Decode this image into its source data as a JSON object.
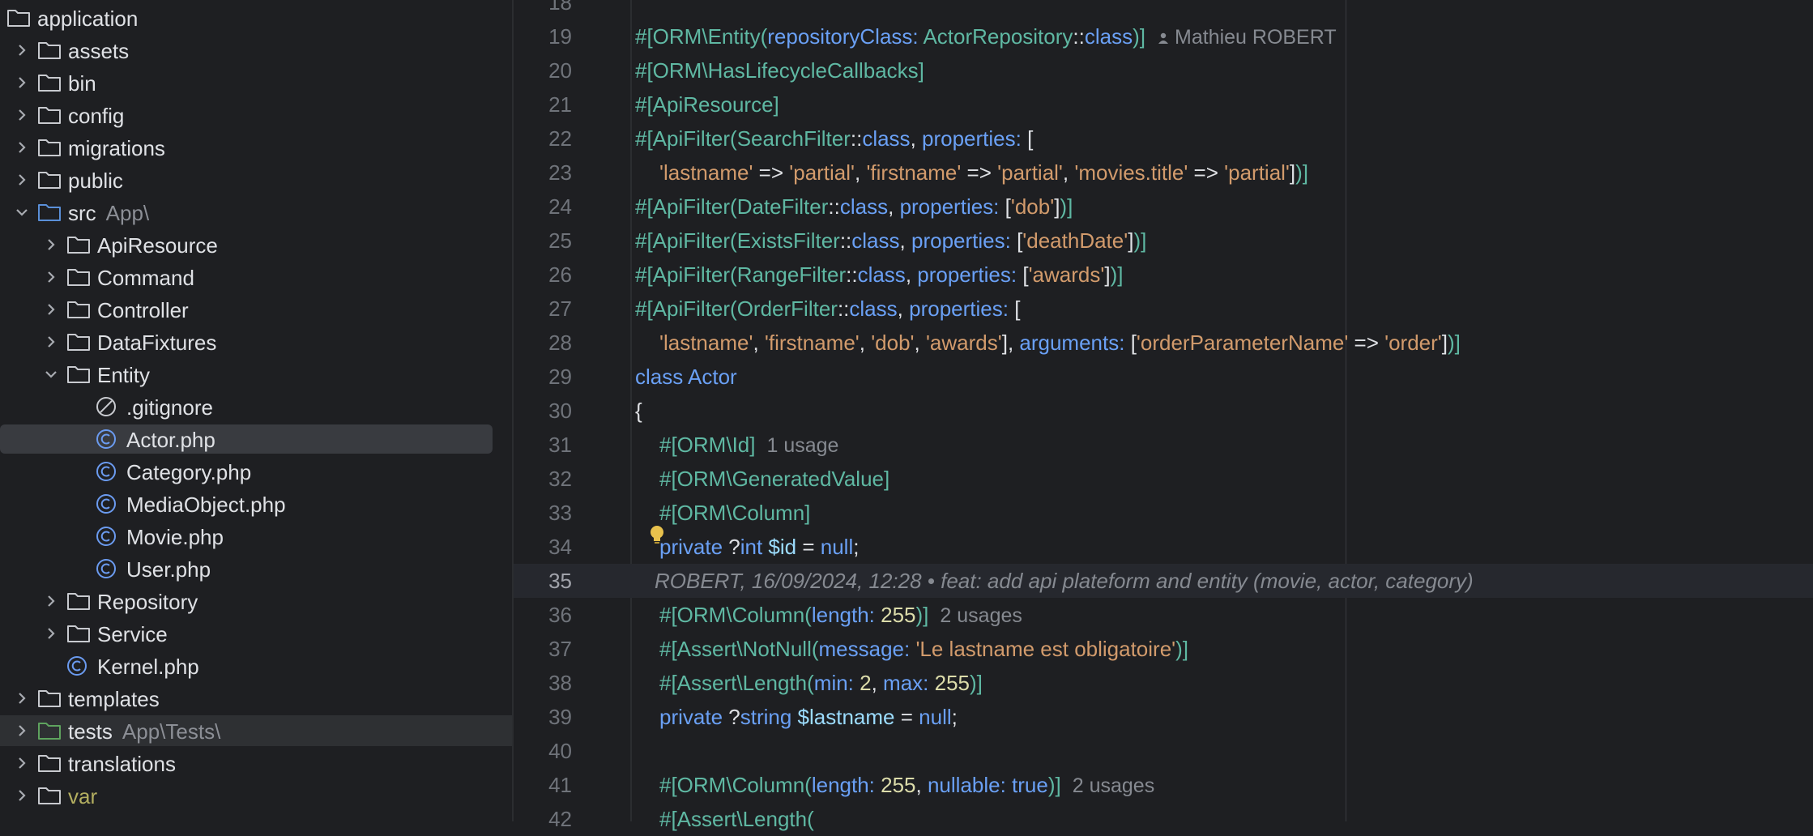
{
  "project_tree": {
    "rows": [
      {
        "label": "application",
        "hint": "",
        "icon": "folder-icon",
        "chevron": "none",
        "indent": 0,
        "color": "default"
      },
      {
        "label": "assets",
        "hint": "",
        "icon": "folder-icon",
        "chevron": "right",
        "indent": 1,
        "color": "default"
      },
      {
        "label": "bin",
        "hint": "",
        "icon": "folder-icon",
        "chevron": "right",
        "indent": 1,
        "color": "default"
      },
      {
        "label": "config",
        "hint": "",
        "icon": "folder-icon",
        "chevron": "right",
        "indent": 1,
        "color": "default"
      },
      {
        "label": "migrations",
        "hint": "",
        "icon": "folder-icon",
        "chevron": "right",
        "indent": 1,
        "color": "default"
      },
      {
        "label": "public",
        "hint": "",
        "icon": "folder-icon",
        "chevron": "right",
        "indent": 1,
        "color": "default"
      },
      {
        "label": "src",
        "hint": "App\\",
        "icon": "source-folder-icon",
        "chevron": "down",
        "indent": 1,
        "color": "default"
      },
      {
        "label": "ApiResource",
        "hint": "",
        "icon": "folder-icon",
        "chevron": "right",
        "indent": 2,
        "color": "default"
      },
      {
        "label": "Command",
        "hint": "",
        "icon": "folder-icon",
        "chevron": "right",
        "indent": 2,
        "color": "default"
      },
      {
        "label": "Controller",
        "hint": "",
        "icon": "folder-icon",
        "chevron": "right",
        "indent": 2,
        "color": "default"
      },
      {
        "label": "DataFixtures",
        "hint": "",
        "icon": "folder-icon",
        "chevron": "right",
        "indent": 2,
        "color": "default"
      },
      {
        "label": "Entity",
        "hint": "",
        "icon": "folder-icon",
        "chevron": "down",
        "indent": 2,
        "color": "default"
      },
      {
        "label": ".gitignore",
        "hint": "",
        "icon": "ignore-file-icon",
        "chevron": "none",
        "indent": 3,
        "color": "default"
      },
      {
        "label": "Actor.php",
        "hint": "",
        "icon": "php-class-icon",
        "chevron": "none",
        "indent": 3,
        "color": "default",
        "selected": true
      },
      {
        "label": "Category.php",
        "hint": "",
        "icon": "php-class-icon",
        "chevron": "none",
        "indent": 3,
        "color": "default"
      },
      {
        "label": "MediaObject.php",
        "hint": "",
        "icon": "php-class-icon",
        "chevron": "none",
        "indent": 3,
        "color": "default"
      },
      {
        "label": "Movie.php",
        "hint": "",
        "icon": "php-class-icon",
        "chevron": "none",
        "indent": 3,
        "color": "default"
      },
      {
        "label": "User.php",
        "hint": "",
        "icon": "php-class-icon",
        "chevron": "none",
        "indent": 3,
        "color": "default"
      },
      {
        "label": "Repository",
        "hint": "",
        "icon": "folder-icon",
        "chevron": "right",
        "indent": 2,
        "color": "default"
      },
      {
        "label": "Service",
        "hint": "",
        "icon": "folder-icon",
        "chevron": "right",
        "indent": 2,
        "color": "default"
      },
      {
        "label": "Kernel.php",
        "hint": "",
        "icon": "php-class-icon",
        "chevron": "none",
        "indent": 2,
        "color": "default"
      },
      {
        "label": "templates",
        "hint": "",
        "icon": "folder-icon",
        "chevron": "right",
        "indent": 1,
        "color": "default"
      },
      {
        "label": "tests",
        "hint": "App\\Tests\\",
        "icon": "test-folder-icon",
        "chevron": "right",
        "indent": 1,
        "color": "default",
        "inactive_selected": true
      },
      {
        "label": "translations",
        "hint": "",
        "icon": "folder-icon",
        "chevron": "right",
        "indent": 1,
        "color": "default"
      },
      {
        "label": "var",
        "hint": "",
        "icon": "folder-icon",
        "chevron": "right",
        "indent": 1,
        "color": "yellow"
      }
    ]
  },
  "editor": {
    "current_line": "35",
    "lines": [
      {
        "n": "18",
        "tokens": []
      },
      {
        "n": "19",
        "indent": 0,
        "tokens": [
          [
            "attr",
            "#[ORM\\Entity("
          ],
          [
            "kw",
            "repositoryClass: "
          ],
          [
            "cls",
            "ActorRepository"
          ],
          [
            "op",
            "::"
          ],
          [
            "kw",
            "class"
          ],
          [
            "attr",
            ")]"
          ]
        ],
        "inlay": "Mathieu ROBERT",
        "inlay_icon": "person-icon"
      },
      {
        "n": "20",
        "indent": 0,
        "tokens": [
          [
            "attr",
            "#[ORM\\HasLifecycleCallbacks]"
          ]
        ]
      },
      {
        "n": "21",
        "indent": 0,
        "tokens": [
          [
            "attr",
            "#[ApiResource]"
          ]
        ]
      },
      {
        "n": "22",
        "indent": 0,
        "tokens": [
          [
            "attr",
            "#[ApiFilter("
          ],
          [
            "cls",
            "SearchFilter"
          ],
          [
            "op",
            "::"
          ],
          [
            "kw",
            "class"
          ],
          [
            "op",
            ", "
          ],
          [
            "kw",
            "properties: "
          ],
          [
            "op",
            "["
          ]
        ]
      },
      {
        "n": "23",
        "indent": 1,
        "tokens": [
          [
            "str",
            "'lastname'"
          ],
          [
            "op",
            " => "
          ],
          [
            "str",
            "'partial'"
          ],
          [
            "op",
            ", "
          ],
          [
            "str",
            "'firstname'"
          ],
          [
            "op",
            " => "
          ],
          [
            "str",
            "'partial'"
          ],
          [
            "op",
            ", "
          ],
          [
            "str",
            "'movies.title'"
          ],
          [
            "op",
            " => "
          ],
          [
            "str",
            "'partial'"
          ],
          [
            "op",
            "]"
          ],
          [
            "attr",
            ")]"
          ]
        ]
      },
      {
        "n": "24",
        "indent": 0,
        "tokens": [
          [
            "attr",
            "#[ApiFilter("
          ],
          [
            "cls",
            "DateFilter"
          ],
          [
            "op",
            "::"
          ],
          [
            "kw",
            "class"
          ],
          [
            "op",
            ", "
          ],
          [
            "kw",
            "properties: "
          ],
          [
            "op",
            "["
          ],
          [
            "str",
            "'dob'"
          ],
          [
            "op",
            "]"
          ],
          [
            "attr",
            ")]"
          ]
        ]
      },
      {
        "n": "25",
        "indent": 0,
        "tokens": [
          [
            "attr",
            "#[ApiFilter("
          ],
          [
            "cls",
            "ExistsFilter"
          ],
          [
            "op",
            "::"
          ],
          [
            "kw",
            "class"
          ],
          [
            "op",
            ", "
          ],
          [
            "kw",
            "properties: "
          ],
          [
            "op",
            "["
          ],
          [
            "str",
            "'deathDate'"
          ],
          [
            "op",
            "]"
          ],
          [
            "attr",
            ")]"
          ]
        ]
      },
      {
        "n": "26",
        "indent": 0,
        "tokens": [
          [
            "attr",
            "#[ApiFilter("
          ],
          [
            "cls",
            "RangeFilter"
          ],
          [
            "op",
            "::"
          ],
          [
            "kw",
            "class"
          ],
          [
            "op",
            ", "
          ],
          [
            "kw",
            "properties: "
          ],
          [
            "op",
            "["
          ],
          [
            "str",
            "'awards'"
          ],
          [
            "op",
            "]"
          ],
          [
            "attr",
            ")]"
          ]
        ]
      },
      {
        "n": "27",
        "indent": 0,
        "tokens": [
          [
            "attr",
            "#[ApiFilter("
          ],
          [
            "cls",
            "OrderFilter"
          ],
          [
            "op",
            "::"
          ],
          [
            "kw",
            "class"
          ],
          [
            "op",
            ", "
          ],
          [
            "kw",
            "properties: "
          ],
          [
            "op",
            "["
          ]
        ]
      },
      {
        "n": "28",
        "indent": 1,
        "tokens": [
          [
            "str",
            "'lastname'"
          ],
          [
            "op",
            ", "
          ],
          [
            "str",
            "'firstname'"
          ],
          [
            "op",
            ", "
          ],
          [
            "str",
            "'dob'"
          ],
          [
            "op",
            ", "
          ],
          [
            "str",
            "'awards'"
          ],
          [
            "op",
            "], "
          ],
          [
            "kw",
            "arguments: "
          ],
          [
            "op",
            "["
          ],
          [
            "str",
            "'orderParameterName'"
          ],
          [
            "op",
            " => "
          ],
          [
            "str",
            "'order'"
          ],
          [
            "op",
            "]"
          ],
          [
            "attr",
            ")]"
          ]
        ]
      },
      {
        "n": "29",
        "indent": 0,
        "tokens": [
          [
            "kw",
            "class "
          ],
          [
            "name",
            "Actor"
          ]
        ]
      },
      {
        "n": "30",
        "indent": 0,
        "tokens": [
          [
            "op",
            "{"
          ]
        ]
      },
      {
        "n": "31",
        "indent": 1,
        "tokens": [
          [
            "attr",
            "#[ORM\\Id]"
          ]
        ],
        "inlay": "1 usage"
      },
      {
        "n": "32",
        "indent": 1,
        "tokens": [
          [
            "attr",
            "#[ORM\\GeneratedValue]"
          ]
        ]
      },
      {
        "n": "33",
        "indent": 1,
        "tokens": [
          [
            "attr",
            "#[ORM\\Column]"
          ]
        ]
      },
      {
        "n": "34",
        "indent": 1,
        "tokens": [
          [
            "kw",
            "private "
          ],
          [
            "op",
            "?"
          ],
          [
            "kw",
            "int "
          ],
          [
            "var",
            "$id"
          ],
          [
            "op",
            " = "
          ],
          [
            "kw",
            "null"
          ],
          [
            "op",
            ";"
          ]
        ]
      },
      {
        "n": "35",
        "indent": 1,
        "blame": "ROBERT, 16/09/2024, 12:28 • feat: add api plateform and entity (movie, actor, category)",
        "tokens": []
      },
      {
        "n": "36",
        "indent": 1,
        "tokens": [
          [
            "attr",
            "#[ORM\\Column("
          ],
          [
            "kw",
            "length: "
          ],
          [
            "num",
            "255"
          ],
          [
            "attr",
            ")]"
          ]
        ],
        "inlay": "2 usages"
      },
      {
        "n": "37",
        "indent": 1,
        "tokens": [
          [
            "attr",
            "#[Assert\\NotNull("
          ],
          [
            "kw",
            "message: "
          ],
          [
            "str",
            "'Le lastname est obligatoire'"
          ],
          [
            "attr",
            ")]"
          ]
        ]
      },
      {
        "n": "38",
        "indent": 1,
        "tokens": [
          [
            "attr",
            "#[Assert\\Length("
          ],
          [
            "kw",
            "min: "
          ],
          [
            "num",
            "2"
          ],
          [
            "op",
            ", "
          ],
          [
            "kw",
            "max: "
          ],
          [
            "num",
            "255"
          ],
          [
            "attr",
            ")]"
          ]
        ]
      },
      {
        "n": "39",
        "indent": 1,
        "tokens": [
          [
            "kw",
            "private "
          ],
          [
            "op",
            "?"
          ],
          [
            "kw",
            "string "
          ],
          [
            "var",
            "$lastname"
          ],
          [
            "op",
            " = "
          ],
          [
            "kw",
            "null"
          ],
          [
            "op",
            ";"
          ]
        ]
      },
      {
        "n": "40",
        "indent": 0,
        "tokens": []
      },
      {
        "n": "41",
        "indent": 1,
        "tokens": [
          [
            "attr",
            "#[ORM\\Column("
          ],
          [
            "kw",
            "length: "
          ],
          [
            "num",
            "255"
          ],
          [
            "op",
            ", "
          ],
          [
            "kw",
            "nullable: "
          ],
          [
            "kw",
            "true"
          ],
          [
            "attr",
            ")]"
          ]
        ],
        "inlay": "2 usages"
      },
      {
        "n": "42",
        "indent": 1,
        "tokens": [
          [
            "attr",
            "#[Assert\\Length("
          ]
        ]
      }
    ]
  },
  "colors": {
    "background": "#1e1f22",
    "keyword": "#6aa0f5",
    "attribute": "#5fb8a3",
    "string": "#d29b6c",
    "number": "#dcdcaa",
    "variable": "#9cdcfe",
    "selection": "#393b40",
    "folder_source": "#5a8fd8",
    "folder_test": "#5ea35e",
    "bulb": "#e8c14d"
  }
}
